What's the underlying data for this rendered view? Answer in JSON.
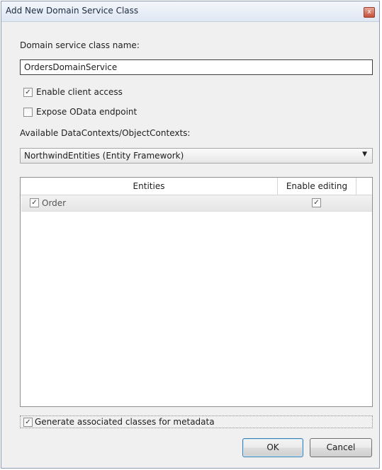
{
  "window": {
    "title": "Add New Domain Service Class",
    "close_glyph": "x"
  },
  "form": {
    "class_name_label": "Domain service class name:",
    "class_name_value": "OrdersDomainService",
    "enable_client_access": {
      "label": "Enable client access",
      "checked": true
    },
    "expose_odata": {
      "label": "Expose OData endpoint",
      "checked": false
    },
    "contexts_label": "Available DataContexts/ObjectContexts:",
    "contexts_selected": "NorthwindEntities (Entity Framework)",
    "dropdown_icon": "dropdown-arrow-icon"
  },
  "entities_grid": {
    "columns": [
      "Entities",
      "Enable editing"
    ],
    "rows": [
      {
        "entity": "Order",
        "selected": true,
        "enable_editing": true
      }
    ]
  },
  "generate_metadata": {
    "label": "Generate associated classes for metadata",
    "checked": true
  },
  "buttons": {
    "ok": "OK",
    "cancel": "Cancel"
  },
  "colors": {
    "title_bar": "#dfe7f3",
    "dialog_bg": "#f0f0f0",
    "close_button": "#c4503b",
    "default_button_border": "#3c7fb1"
  }
}
